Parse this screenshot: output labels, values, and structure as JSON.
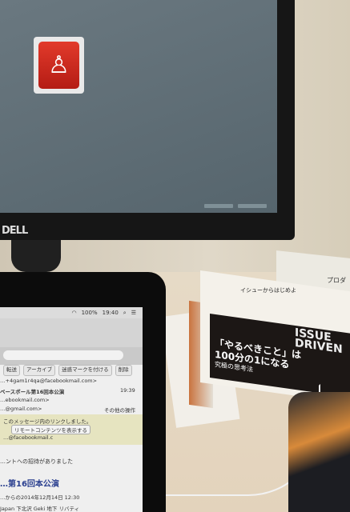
{
  "monitor": {
    "brand": "DELL",
    "app_icon": "person-icon",
    "app_icon_color": "#d42a1e"
  },
  "ipad": {
    "status": {
      "battery": "100%",
      "time": "19:40"
    },
    "actions": [
      "転送",
      "アーカイブ",
      "迷惑マークを付ける",
      "削除"
    ],
    "email": {
      "from": "…+4gam1r4qa@facebookmail.com>",
      "subject": "ベースボール第16回本公演",
      "time": "19:39",
      "to1": "…ebookmail.com>",
      "to2": "…@gmail.com>",
      "other": "その他の操作",
      "notice": "このメッセージ内のリンクしました。",
      "remote_button": "リモートコンテンツを表示する",
      "notice_from": "…@facebookmail.c",
      "invite": "…ントへの招待がありました",
      "event_title": "…第16回本公演",
      "event_date": "…からの2014年12月14日 12:30",
      "event_place": "Japan 下北沢 Geki 地下 リバティ"
    }
  },
  "book": {
    "title": "イシューからはじめよ",
    "cover_en": "ISSUE DRIVEN",
    "tagline1": "「やるべきこと」は",
    "tagline2": "100分の1になる",
    "footer": "究極の思考法"
  },
  "book_right": {
    "text": "プロダ"
  }
}
